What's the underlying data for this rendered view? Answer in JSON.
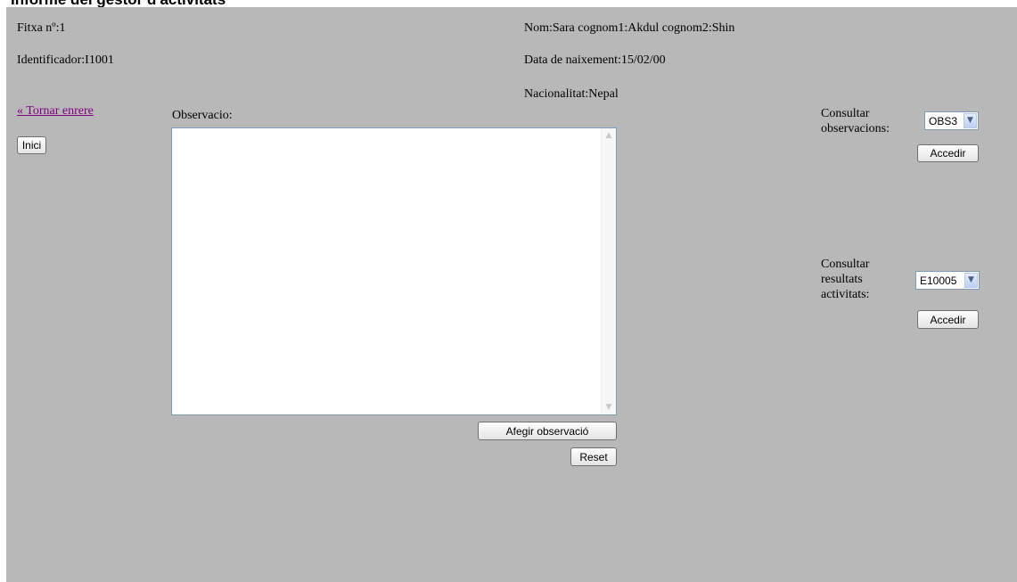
{
  "page_title": "Informe del gestor d'activitats",
  "patient": {
    "file_number": "Fitxa nº:1",
    "identifier": "Identificador:I1001",
    "name": "Nom:Sara cognom1:Akdul cognom2:Shin",
    "birth_date": "Data de naixement:15/02/00",
    "nationality": "Nacionalitat:Nepal"
  },
  "nav": {
    "back_link": "« Tornar enrere",
    "home_button": "Inici"
  },
  "observation": {
    "label": "Observacio:",
    "value": "",
    "add_button": "Afegir observació",
    "reset_button": "Reset"
  },
  "consult_observations": {
    "label_line1": "Consultar",
    "label_line2": "observacions:",
    "selected": "OBS3",
    "button": "Accedir"
  },
  "consult_results": {
    "label_line1": "Consultar",
    "label_line2": "resultats",
    "label_line3": "activitats:",
    "selected": "E10005",
    "button": "Accedir"
  },
  "colors": {
    "panel_background": "#b8b8b8",
    "link_visited": "#800080"
  }
}
